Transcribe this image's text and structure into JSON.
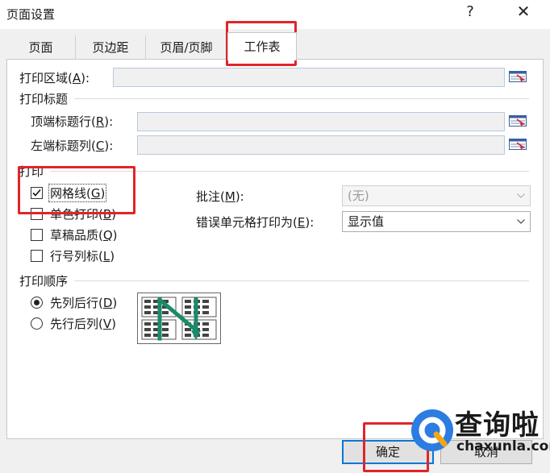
{
  "window": {
    "title": "页面设置",
    "help": "?",
    "close": "✕"
  },
  "tabs": [
    "页面",
    "页边距",
    "页眉/页脚",
    "工作表"
  ],
  "print_area": {
    "label": "打印区域(",
    "key": "A",
    "suffix": "):",
    "value": ""
  },
  "print_titles": {
    "heading": "打印标题",
    "rows_label": "顶端标题行(",
    "rows_key": "R",
    "rows_suffix": "):",
    "cols_label": "左端标题列(",
    "cols_key": "C",
    "cols_suffix": "):"
  },
  "print": {
    "heading": "打印",
    "gridlines": {
      "label": "网格线(",
      "key": "G",
      "suffix": ")",
      "checked": true
    },
    "mono": {
      "label": "单色打印(",
      "key": "B",
      "suffix": ")",
      "checked": false
    },
    "draft": {
      "label": "草稿品质(",
      "key": "Q",
      "suffix": ")",
      "checked": false
    },
    "headings": {
      "label": "行号列标(",
      "key": "L",
      "suffix": ")",
      "checked": false
    },
    "comments": {
      "label": "批注(",
      "key": "M",
      "suffix": "):",
      "value": "(无)"
    },
    "errors": {
      "label": "错误单元格打印为(",
      "key": "E",
      "suffix": "):",
      "value": "显示值"
    }
  },
  "order": {
    "heading": "打印顺序",
    "down_then_over": {
      "label": "先列后行(",
      "key": "D",
      "suffix": ")",
      "selected": true
    },
    "over_then_down": {
      "label": "先行后列(",
      "key": "V",
      "suffix": ")",
      "selected": false
    }
  },
  "buttons": {
    "ok": "确定",
    "cancel": "取消"
  },
  "watermark": {
    "brand": "查询啦",
    "url": "chaxunla.com"
  },
  "colors": {
    "accent": "#0078d7",
    "highlight": "#e0252a",
    "arrow": "#1b8a6b"
  }
}
